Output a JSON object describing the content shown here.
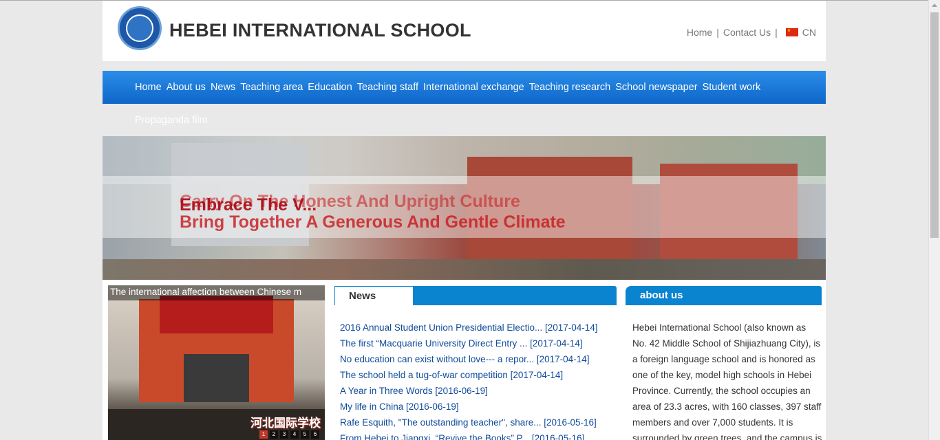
{
  "header": {
    "logo_text": "HEBEI INTERNATIONAL SCHOOL",
    "links": [
      "Home",
      "Contact Us"
    ],
    "separator": "|",
    "language": "CN"
  },
  "nav": {
    "items": [
      "Home",
      "About us",
      "News",
      "Teaching area",
      "Education",
      "Teaching staff",
      "International exchange",
      "Teaching research",
      "School newspaper",
      "Student work"
    ],
    "overflow_item": "Propaganda film"
  },
  "banner": {
    "overlap_text": "Embrace The V...",
    "slogan_line1": "Carry On The Honest And Upright Culture",
    "slogan_line2": "Bring Together A Generous And Gentle Climate"
  },
  "slideshow": {
    "caption": "The international affection between Chinese m",
    "watermark": "河北国际学校",
    "pages": [
      "1",
      "2",
      "3",
      "4",
      "5",
      "6"
    ],
    "active_page": "1"
  },
  "news": {
    "title": "News",
    "items": [
      "2016 Annual Student Union Presidential Electio... [2017-04-14]",
      "The first “Macquarie University Direct Entry ... [2017-04-14]",
      "No education can exist without love--- a repor... [2017-04-14]",
      "The school held a tug-of-war competition [2017-04-14]",
      "A Year in Three Words [2016-06-19]",
      "My life in China [2016-06-19]",
      "Rafe Esquith, \"The outstanding teacher\", share... [2016-05-16]",
      "From Hebei to Jiangxi, “Revive the Books” P... [2016-05-16]"
    ]
  },
  "about": {
    "title": "about us",
    "text": "Hebei International School (also known as No. 42 Middle School of Shijiazhuang City), is a foreign language school and is honored as one of the key, model high schools in Hebei Province. Currently, the school occupies an area of 23.3 acres, with 160 classes, 397 staff members and over 7,000 students. It is surrounded by green trees, and the campus is"
  },
  "colors": {
    "nav_blue": "#0e66c9",
    "panel_blue": "#0b84cf",
    "link_blue": "#0f4b9b",
    "slogan_red": "#c8181c"
  }
}
